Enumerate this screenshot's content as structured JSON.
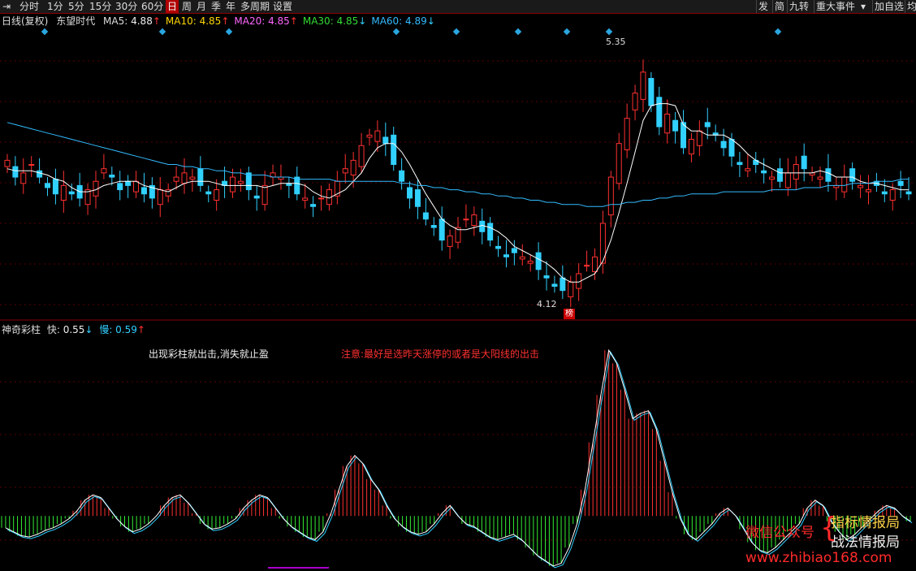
{
  "toolbar": {
    "items": [
      "分时",
      "1分",
      "5分",
      "15分",
      "30分",
      "60分",
      "日",
      "周",
      "月",
      "季",
      "年",
      "多周期",
      "设置"
    ],
    "selected": "日",
    "right_items": [
      "发",
      "简",
      "九转",
      "重大事件",
      "加自选",
      "均"
    ]
  },
  "main": {
    "period": "日线(复权)",
    "stock": "东望时代",
    "ma": [
      {
        "label": "MA5: ",
        "value": "4.88",
        "arrow": "↑",
        "color": "#ffffff"
      },
      {
        "label": "MA10: ",
        "value": "4.85",
        "arrow": "↑",
        "color": "#ffd700"
      },
      {
        "label": "MA20: ",
        "value": "4.85",
        "arrow": "↑",
        "color": "#ff66ff"
      },
      {
        "label": "MA30: ",
        "value": "4.85",
        "arrow": "↓",
        "color": "#33dd33"
      },
      {
        "label": "MA60: ",
        "value": "4.89",
        "arrow": "↓",
        "color": "#33bbff"
      }
    ],
    "high_label": "5.35",
    "low_label": "4.12",
    "rank_badge": "榜"
  },
  "indicator": {
    "name": "神奇彩柱",
    "fast_label": "快: ",
    "fast_value": "0.55",
    "fast_arrow": "↓",
    "slow_label": "慢: ",
    "slow_value": "0.59",
    "slow_arrow": "↑",
    "note1": "出现彩柱就出击,消失就止盈",
    "note2": "注意:最好是选昨天涨停的或者是大阳线的出击"
  },
  "watermark": {
    "wechat": "微信公众号",
    "name1": "指标情报局",
    "name2": "战法情报局",
    "url": "www.zhibiao168.com"
  },
  "colors": {
    "up": "#ff3030",
    "down": "#30d0ff",
    "bg": "#000000",
    "grid": "#5a0000"
  },
  "chart_data": {
    "type": "candlestick",
    "price_range": [
      4.12,
      5.35
    ],
    "close": [
      4.78,
      4.7,
      4.72,
      4.76,
      4.7,
      4.65,
      4.62,
      4.66,
      4.62,
      4.6,
      4.64,
      4.68,
      4.74,
      4.7,
      4.64,
      4.66,
      4.68,
      4.62,
      4.6,
      4.64,
      4.64,
      4.7,
      4.72,
      4.7,
      4.66,
      4.62,
      4.64,
      4.66,
      4.7,
      4.68,
      4.64,
      4.6,
      4.66,
      4.72,
      4.7,
      4.66,
      4.62,
      4.6,
      4.56,
      4.6,
      4.64,
      4.68,
      4.74,
      4.78,
      4.85,
      4.9,
      4.92,
      4.86,
      4.76,
      4.68,
      4.6,
      4.56,
      4.5,
      4.46,
      4.4,
      4.42,
      4.46,
      4.5,
      4.52,
      4.44,
      4.4,
      4.36,
      4.32,
      4.34,
      4.32,
      4.3,
      4.26,
      4.22,
      4.18,
      4.16,
      4.2,
      4.24,
      4.28,
      4.32,
      4.48,
      4.7,
      4.86,
      4.98,
      5.1,
      5.2,
      5.04,
      4.94,
      5.0,
      4.92,
      4.84,
      4.88,
      4.92,
      4.94,
      4.9,
      4.84,
      4.8,
      4.76,
      4.74,
      4.76,
      4.72,
      4.7,
      4.68,
      4.72,
      4.76,
      4.74,
      4.72,
      4.7,
      4.68,
      4.66,
      4.7,
      4.68,
      4.66,
      4.64,
      4.66,
      4.62,
      4.64,
      4.66,
      4.62
    ],
    "ma_series": {
      "MA5": [
        4.74,
        4.73,
        4.73,
        4.73,
        4.72,
        4.71,
        4.69,
        4.68,
        4.65,
        4.63,
        4.63,
        4.64,
        4.66,
        4.67,
        4.68,
        4.68,
        4.68,
        4.66,
        4.65,
        4.64,
        4.63,
        4.65,
        4.67,
        4.68,
        4.68,
        4.68,
        4.67,
        4.66,
        4.66,
        4.66,
        4.66,
        4.66,
        4.65,
        4.66,
        4.67,
        4.67,
        4.67,
        4.66,
        4.63,
        4.61,
        4.6,
        4.62,
        4.64,
        4.68,
        4.72,
        4.79,
        4.84,
        4.86,
        4.86,
        4.82,
        4.76,
        4.69,
        4.62,
        4.56,
        4.5,
        4.47,
        4.45,
        4.45,
        4.46,
        4.47,
        4.46,
        4.44,
        4.41,
        4.37,
        4.35,
        4.33,
        4.31,
        4.29,
        4.26,
        4.22,
        4.2,
        4.2,
        4.22,
        4.24,
        4.3,
        4.4,
        4.53,
        4.67,
        4.82,
        4.97,
        5.04,
        5.05,
        5.05,
        5.04,
        4.95,
        4.92,
        4.92,
        4.9,
        4.9,
        4.9,
        4.88,
        4.85,
        4.81,
        4.78,
        4.76,
        4.74,
        4.72,
        4.72,
        4.72,
        4.72,
        4.72,
        4.73,
        4.72,
        4.7,
        4.7,
        4.7,
        4.68,
        4.67,
        4.67,
        4.66,
        4.65,
        4.64,
        4.64
      ],
      "MA60": [
        4.96,
        4.95,
        4.94,
        4.93,
        4.92,
        4.91,
        4.9,
        4.89,
        4.88,
        4.87,
        4.86,
        4.85,
        4.84,
        4.83,
        4.82,
        4.81,
        4.8,
        4.79,
        4.78,
        4.77,
        4.76,
        4.76,
        4.75,
        4.75,
        4.74,
        4.74,
        4.73,
        4.73,
        4.72,
        4.72,
        4.71,
        4.71,
        4.71,
        4.7,
        4.7,
        4.7,
        4.69,
        4.69,
        4.69,
        4.69,
        4.69,
        4.68,
        4.68,
        4.68,
        4.68,
        4.68,
        4.68,
        4.68,
        4.68,
        4.67,
        4.67,
        4.66,
        4.66,
        4.65,
        4.65,
        4.64,
        4.64,
        4.63,
        4.63,
        4.62,
        4.62,
        4.61,
        4.61,
        4.6,
        4.6,
        4.59,
        4.59,
        4.58,
        4.58,
        4.57,
        4.57,
        4.57,
        4.56,
        4.56,
        4.56,
        4.57,
        4.57,
        4.58,
        4.58,
        4.59,
        4.59,
        4.6,
        4.6,
        4.61,
        4.61,
        4.62,
        4.62,
        4.62,
        4.62,
        4.63,
        4.63,
        4.63,
        4.63,
        4.63,
        4.63,
        4.64,
        4.64,
        4.64,
        4.64,
        4.65,
        4.65,
        4.65,
        4.66,
        4.66,
        4.66,
        4.67,
        4.67,
        4.67,
        4.68,
        4.68,
        4.68,
        4.69,
        4.69
      ]
    },
    "indicator_values": [
      0.55,
      0.52,
      0.49,
      0.48,
      0.5,
      0.53,
      0.55,
      0.58,
      0.62,
      0.68,
      0.76,
      0.8,
      0.78,
      0.7,
      0.62,
      0.56,
      0.52,
      0.54,
      0.58,
      0.64,
      0.72,
      0.78,
      0.8,
      0.74,
      0.66,
      0.58,
      0.54,
      0.55,
      0.58,
      0.62,
      0.7,
      0.76,
      0.8,
      0.78,
      0.7,
      0.62,
      0.56,
      0.52,
      0.48,
      0.46,
      0.52,
      0.66,
      0.84,
      1.02,
      1.1,
      1.04,
      0.92,
      0.84,
      0.72,
      0.62,
      0.56,
      0.52,
      0.5,
      0.52,
      0.58,
      0.66,
      0.72,
      0.64,
      0.58,
      0.56,
      0.52,
      0.48,
      0.46,
      0.48,
      0.5,
      0.46,
      0.4,
      0.34,
      0.3,
      0.26,
      0.28,
      0.4,
      0.58,
      0.84,
      1.2,
      1.56,
      1.9,
      1.8,
      1.6,
      1.38,
      1.42,
      1.44,
      1.3,
      1.06,
      0.82,
      0.62,
      0.5,
      0.46,
      0.52,
      0.58,
      0.66,
      0.7,
      0.64,
      0.54,
      0.44,
      0.38,
      0.36,
      0.4,
      0.46,
      0.52,
      0.58,
      0.7,
      0.76,
      0.72,
      0.6,
      0.52,
      0.46,
      0.5,
      0.56,
      0.62,
      0.68,
      0.72,
      0.7,
      0.64,
      0.6
    ],
    "indicator_zero_line": 0.64,
    "indicator_range": [
      0.24,
      2.0
    ]
  }
}
